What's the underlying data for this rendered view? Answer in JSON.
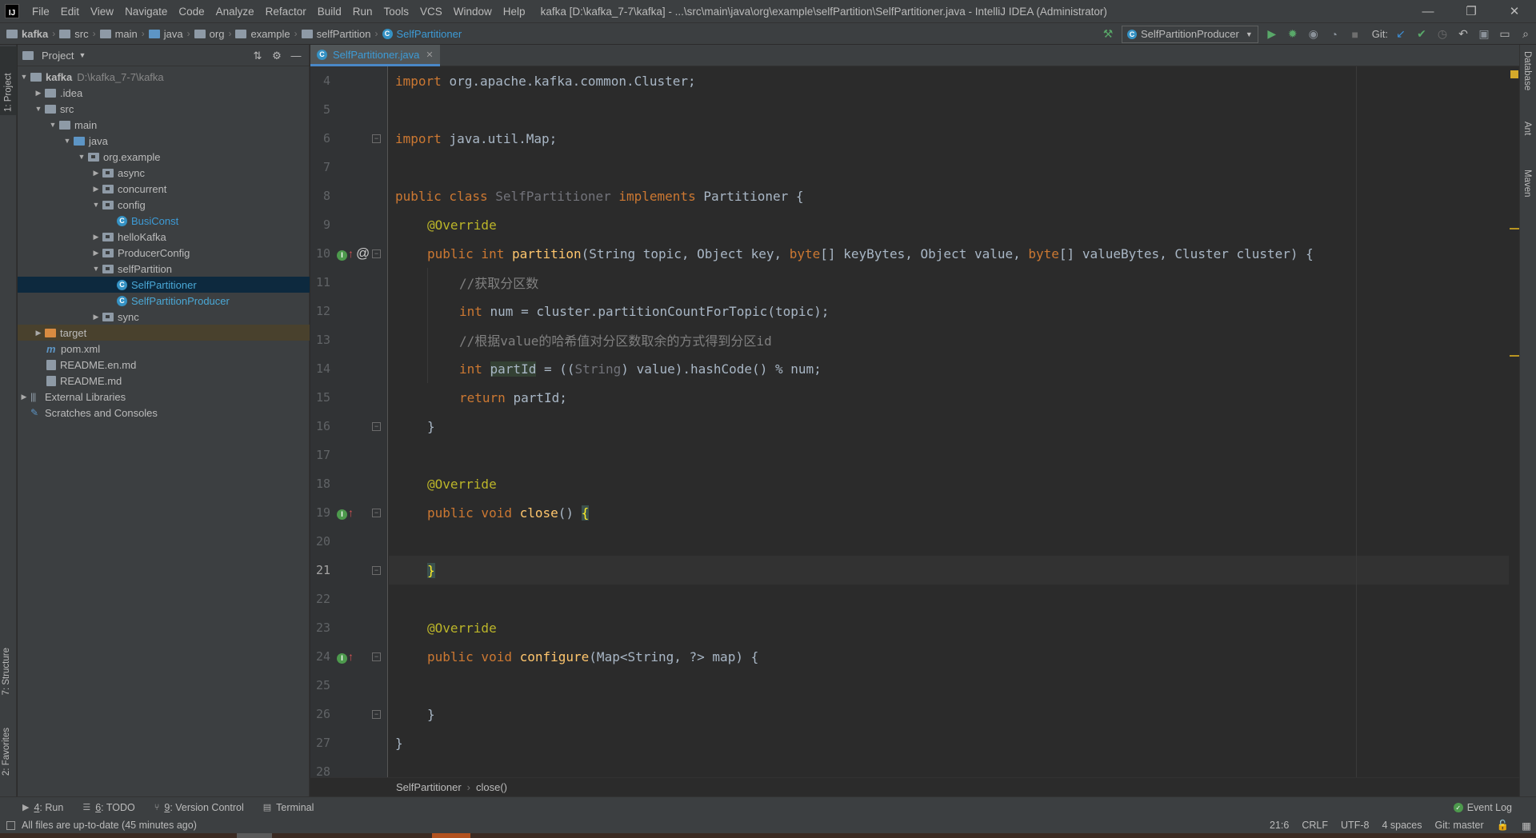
{
  "menu": [
    "File",
    "Edit",
    "View",
    "Navigate",
    "Code",
    "Analyze",
    "Refactor",
    "Build",
    "Run",
    "Tools",
    "VCS",
    "Window",
    "Help"
  ],
  "window_title": "kafka [D:\\kafka_7-7\\kafka] - ...\\src\\main\\java\\org\\example\\selfPartition\\SelfPartitioner.java - IntelliJ IDEA (Administrator)",
  "window_controls": {
    "minimize": "—",
    "restore": "❐",
    "close": "✕"
  },
  "breadcrumb": [
    "kafka",
    "src",
    "main",
    "java",
    "org",
    "example",
    "selfPartition",
    "SelfPartitioner"
  ],
  "run_config": "SelfPartitionProducer",
  "git_label": "Git:",
  "left_stripe": {
    "project": "1: Project",
    "structure": "7: Structure",
    "favorites": "2: Favorites"
  },
  "right_stripe": {
    "database": "Database",
    "ant": "Ant",
    "maven": "Maven"
  },
  "project_panel": {
    "title": "Project"
  },
  "tree": {
    "root_name": "kafka",
    "root_path": "D:\\kafka_7-7\\kafka",
    "idea": ".idea",
    "src": "src",
    "main": "main",
    "java": "java",
    "org_example": "org.example",
    "async": "async",
    "concurrent": "concurrent",
    "config": "config",
    "busiconst": "BusiConst",
    "hellokafka": "helloKafka",
    "producerconfig": "ProducerConfig",
    "selfpartition": "selfPartition",
    "selfpartitioner": "SelfPartitioner",
    "selfpartitionproducer": "SelfPartitionProducer",
    "sync": "sync",
    "target": "target",
    "pom": "pom.xml",
    "readme_en": "README.en.md",
    "readme": "README.md",
    "external_libs": "External Libraries",
    "scratches": "Scratches and Consoles"
  },
  "editor": {
    "tab_label": "SelfPartitioner.java",
    "line_numbers": [
      "4",
      "5",
      "6",
      "7",
      "8",
      "9",
      "10",
      "11",
      "12",
      "13",
      "14",
      "15",
      "16",
      "17",
      "18",
      "19",
      "20",
      "21",
      "22",
      "23",
      "24",
      "25",
      "26",
      "27",
      "28"
    ],
    "current_line": "21",
    "code": {
      "l4_import": "import ",
      "l4_rest": "org.apache.kafka.common.Cluster;",
      "l6_import": "import ",
      "l6_rest": "java.util.Map;",
      "l8_public_class": "public class ",
      "l8_name": "SelfPartitioner",
      "l8_implements": " implements ",
      "l8_iface": "Partitioner {",
      "ann_override": "@Override",
      "l10_public_int": "public int ",
      "l10_fn": "partition",
      "l10_p1": "(String topic, Object key, ",
      "l10_byte1": "byte",
      "l10_p2": "[] keyBytes, Object value, ",
      "l10_byte2": "byte",
      "l10_p3": "[] valueBytes, Cluster cluster) {",
      "l11_comment": "//获取分区数",
      "l12_int": "int ",
      "l12_rest": "num = cluster.partitionCountForTopic(topic);",
      "l13_comment": "//根据value的哈希值对分区数取余的方式得到分区id",
      "l14_int": "int ",
      "l14_var": "partId",
      "l14_a": " = ((",
      "l14_cast": "String",
      "l14_b": ") value).hashCode() % num;",
      "l15_return": "return ",
      "l15_rest": "partId;",
      "close_brace": "}",
      "l19_public_void": "public void ",
      "l19_fn": "close",
      "l19_paren": "() ",
      "l19_brace": "{",
      "l21_brace": "}",
      "l24_public_void": "public void ",
      "l24_fn": "configure",
      "l24_rest": "(Map<String, ?> map) {"
    },
    "crumbs": [
      "SelfPartitioner",
      "close()"
    ]
  },
  "gutter_icons": {
    "implements": "I",
    "up_arrow": "↑",
    "at": "@"
  },
  "bottom_tools": [
    {
      "num": "4",
      "label": ": Run"
    },
    {
      "num": "6",
      "label": ": TODO"
    },
    {
      "num": "9",
      "label": ": Version Control"
    },
    {
      "num": "",
      "label": "Terminal"
    }
  ],
  "event_log": "Event Log",
  "status": {
    "message": "All files are up-to-date (45 minutes ago)",
    "position": "21:6",
    "line_sep": "CRLF",
    "encoding": "UTF-8",
    "indent": "4 spaces",
    "git_branch": "Git: master"
  },
  "colors": {
    "keyword": "#cc7832",
    "annotation": "#bbb529",
    "comment": "#808080",
    "function": "#ffc66d",
    "text": "#a9b7c6",
    "selection": "#0d293e",
    "accent": "#4a88c7"
  }
}
